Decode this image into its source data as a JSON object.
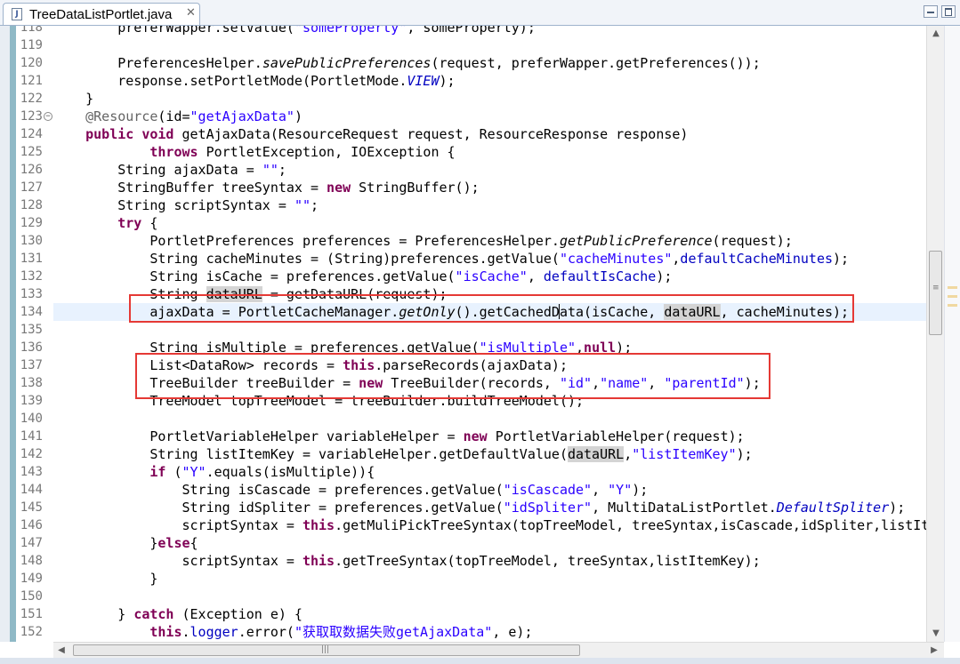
{
  "window": {
    "tab_title": "TreeDataListPortlet.java",
    "tab_icon": "java-file-icon",
    "close_glyph": "✕",
    "minimize_icon": "minimize-icon",
    "maximize_icon": "maximize-icon"
  },
  "editor": {
    "current_line": "134",
    "highlight_color": "#e53935",
    "lines": [
      {
        "n": "118",
        "s": [
          [
            "        preferWapper.setValue(",
            ""
          ],
          [
            "\"someProperty\"",
            "str"
          ],
          [
            ", someProperty);",
            ""
          ]
        ]
      },
      {
        "n": "119",
        "s": []
      },
      {
        "n": "120",
        "s": [
          [
            "        PreferencesHelper.",
            ""
          ],
          [
            "savePublicPreferences",
            "it"
          ],
          [
            "(request, preferWapper.getPreferences());",
            ""
          ]
        ]
      },
      {
        "n": "121",
        "s": [
          [
            "        response.setPortletMode(PortletMode.",
            ""
          ],
          [
            "VIEW",
            "fld"
          ],
          [
            ");",
            ""
          ]
        ]
      },
      {
        "n": "122",
        "s": [
          [
            "    }",
            ""
          ]
        ]
      },
      {
        "n": "123",
        "fold": true,
        "s": [
          [
            "    ",
            ""
          ],
          [
            "@Resource",
            "ann"
          ],
          [
            "(id=",
            ""
          ],
          [
            "\"getAjaxData\"",
            "str"
          ],
          [
            ")",
            ""
          ]
        ]
      },
      {
        "n": "124",
        "s": [
          [
            "    ",
            ""
          ],
          [
            "public",
            "kw"
          ],
          [
            " ",
            ""
          ],
          [
            "void",
            "kw"
          ],
          [
            " getAjaxData(ResourceRequest request, ResourceResponse response)",
            ""
          ]
        ]
      },
      {
        "n": "125",
        "s": [
          [
            "            ",
            ""
          ],
          [
            "throws",
            "kw"
          ],
          [
            " PortletException, IOException {",
            ""
          ]
        ]
      },
      {
        "n": "126",
        "s": [
          [
            "        String ajaxData = ",
            ""
          ],
          [
            "\"\"",
            "str"
          ],
          [
            ";",
            ""
          ]
        ]
      },
      {
        "n": "127",
        "s": [
          [
            "        StringBuffer treeSyntax = ",
            ""
          ],
          [
            "new",
            "kw"
          ],
          [
            " StringBuffer();",
            ""
          ]
        ]
      },
      {
        "n": "128",
        "s": [
          [
            "        String scriptSyntax = ",
            ""
          ],
          [
            "\"\"",
            "str"
          ],
          [
            ";",
            ""
          ]
        ]
      },
      {
        "n": "129",
        "s": [
          [
            "        ",
            ""
          ],
          [
            "try",
            "kw"
          ],
          [
            " {",
            ""
          ]
        ]
      },
      {
        "n": "130",
        "s": [
          [
            "            PortletPreferences preferences = PreferencesHelper.",
            ""
          ],
          [
            "getPublicPreference",
            "it"
          ],
          [
            "(request);",
            ""
          ]
        ]
      },
      {
        "n": "131",
        "s": [
          [
            "            String cacheMinutes = (String)preferences.getValue(",
            ""
          ],
          [
            "\"cacheMinutes\"",
            "str"
          ],
          [
            ",",
            ""
          ],
          [
            "defaultCacheMinutes",
            "fld2"
          ],
          [
            ");",
            ""
          ]
        ]
      },
      {
        "n": "132",
        "s": [
          [
            "            String isCache = preferences.getValue(",
            ""
          ],
          [
            "\"isCache\"",
            "str"
          ],
          [
            ", ",
            ""
          ],
          [
            "defaultIsCache",
            "fld2"
          ],
          [
            ");",
            ""
          ]
        ]
      },
      {
        "n": "133",
        "s": [
          [
            "            String ",
            ""
          ],
          [
            "dataURL",
            "occ"
          ],
          [
            " = getDataURL(request);",
            ""
          ]
        ]
      },
      {
        "n": "134",
        "s": [
          [
            "            ajaxData = PortletCacheManager.",
            ""
          ],
          [
            "getOnly",
            "it"
          ],
          [
            "().getCachedD",
            ""
          ],
          [
            "|",
            "caret"
          ],
          [
            "ata(isCache, ",
            ""
          ],
          [
            "dataURL",
            "occ"
          ],
          [
            ", cacheMinutes);",
            ""
          ]
        ]
      },
      {
        "n": "135",
        "s": []
      },
      {
        "n": "136",
        "s": [
          [
            "            String isMultiple = preferences.getValue(",
            ""
          ],
          [
            "\"isMultiple\"",
            "str"
          ],
          [
            ",",
            ""
          ],
          [
            "null",
            "kw"
          ],
          [
            ");",
            ""
          ]
        ]
      },
      {
        "n": "137",
        "s": [
          [
            "            List<DataRow> records = ",
            ""
          ],
          [
            "this",
            "kw"
          ],
          [
            ".parseRecords(ajaxData);",
            ""
          ]
        ]
      },
      {
        "n": "138",
        "s": [
          [
            "            TreeBuilder treeBuilder = ",
            ""
          ],
          [
            "new",
            "kw"
          ],
          [
            " TreeBuilder(records, ",
            ""
          ],
          [
            "\"id\"",
            "str"
          ],
          [
            ",",
            ""
          ],
          [
            "\"name\"",
            "str"
          ],
          [
            ", ",
            ""
          ],
          [
            "\"parentId\"",
            "str"
          ],
          [
            ");",
            ""
          ]
        ]
      },
      {
        "n": "139",
        "s": [
          [
            "            TreeModel topTreeModel = treeBuilder.buildTreeModel();",
            ""
          ]
        ]
      },
      {
        "n": "140",
        "s": []
      },
      {
        "n": "141",
        "s": [
          [
            "            PortletVariableHelper variableHelper = ",
            ""
          ],
          [
            "new",
            "kw"
          ],
          [
            " PortletVariableHelper(request);",
            ""
          ]
        ]
      },
      {
        "n": "142",
        "s": [
          [
            "            String listItemKey = variableHelper.getDefaultValue(",
            ""
          ],
          [
            "dataURL",
            "occ"
          ],
          [
            ",",
            ""
          ],
          [
            "\"listItemKey\"",
            "str"
          ],
          [
            ");",
            ""
          ]
        ]
      },
      {
        "n": "143",
        "s": [
          [
            "            ",
            ""
          ],
          [
            "if",
            "kw"
          ],
          [
            " (",
            ""
          ],
          [
            "\"Y\"",
            "str"
          ],
          [
            ".equals(isMultiple)){",
            ""
          ]
        ]
      },
      {
        "n": "144",
        "s": [
          [
            "                String isCascade = preferences.getValue(",
            ""
          ],
          [
            "\"isCascade\"",
            "str"
          ],
          [
            ", ",
            ""
          ],
          [
            "\"Y\"",
            "str"
          ],
          [
            ");",
            ""
          ]
        ]
      },
      {
        "n": "145",
        "s": [
          [
            "                String idSpliter = preferences.getValue(",
            ""
          ],
          [
            "\"idSpliter\"",
            "str"
          ],
          [
            ", MultiDataListPortlet.",
            ""
          ],
          [
            "DefaultSpliter",
            "fld"
          ],
          [
            ");",
            ""
          ]
        ]
      },
      {
        "n": "146",
        "s": [
          [
            "                scriptSyntax = ",
            ""
          ],
          [
            "this",
            "kw"
          ],
          [
            ".getMuliPickTreeSyntax(topTreeModel, treeSyntax,isCascade,idSpliter,listIt",
            ""
          ]
        ]
      },
      {
        "n": "147",
        "s": [
          [
            "            }",
            ""
          ],
          [
            "else",
            "kw"
          ],
          [
            "{",
            ""
          ]
        ]
      },
      {
        "n": "148",
        "s": [
          [
            "                scriptSyntax = ",
            ""
          ],
          [
            "this",
            "kw"
          ],
          [
            ".getTreeSyntax(topTreeModel, treeSyntax,listItemKey);",
            ""
          ]
        ]
      },
      {
        "n": "149",
        "s": [
          [
            "            }",
            ""
          ]
        ]
      },
      {
        "n": "150",
        "s": []
      },
      {
        "n": "151",
        "s": [
          [
            "        } ",
            ""
          ],
          [
            "catch",
            "kw"
          ],
          [
            " (Exception e) {",
            ""
          ]
        ]
      },
      {
        "n": "152",
        "s": [
          [
            "            ",
            ""
          ],
          [
            "this",
            "kw"
          ],
          [
            ".",
            ""
          ],
          [
            "logger",
            "fld2"
          ],
          [
            ".error(",
            ""
          ],
          [
            "\"获取取数据失败getAjaxData\"",
            "str"
          ],
          [
            ", e);",
            ""
          ]
        ]
      }
    ]
  },
  "scrollbar": {
    "up_glyph": "▲",
    "down_glyph": "▼",
    "left_glyph": "◀",
    "right_glyph": "▶",
    "grip_glyph": "≡",
    "hgrip_glyph": "|||"
  }
}
